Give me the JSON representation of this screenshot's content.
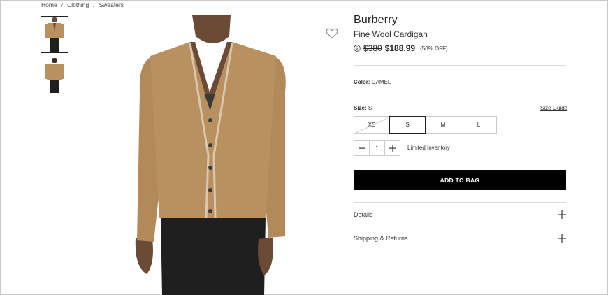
{
  "breadcrumb": {
    "home": "Home",
    "sep": "/",
    "clothing": "Clothing",
    "sweaters": "Sweaters"
  },
  "product": {
    "brand": "Burberry",
    "name": "Fine Wool Cardigan",
    "old_price": "$380",
    "price": "$188.99",
    "discount": "(50% OFF)",
    "color_label": "Color:",
    "color_value": "CAMEL",
    "size_label": "Size:",
    "size_value": "S",
    "size_guide": "Size Guide",
    "sizes": [
      "XS",
      "S",
      "M",
      "L"
    ],
    "quantity": "1",
    "inventory_note": "Limited Inventory",
    "add_to_bag": "ADD TO BAG"
  },
  "accordion": {
    "details": "Details",
    "shipping": "Shipping & Returns"
  },
  "colors": {
    "sweater": "#b9905f",
    "pants": "#1f1f1f",
    "skin": "#6b4a36",
    "button": "#000000"
  },
  "icons": [
    "heart-icon",
    "info-icon",
    "minus-icon",
    "plus-icon"
  ]
}
